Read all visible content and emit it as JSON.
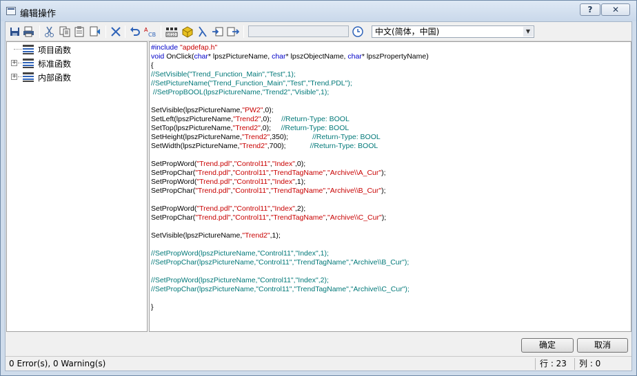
{
  "window": {
    "title": "编辑操作",
    "help_label": "?",
    "close_label": "✕"
  },
  "toolbar": {
    "language_value": "中文(简体，中国)",
    "icons": [
      "save-icon",
      "print-icon",
      "cut-icon",
      "copy-icon",
      "paste-icon",
      "format-icon",
      "delete-icon",
      "undo-icon",
      "abc-icon",
      "compile-icon",
      "cube-icon",
      "lambda-icon",
      "import-icon",
      "export-icon",
      "clock-icon"
    ]
  },
  "tree": {
    "items": [
      {
        "label": "项目函数",
        "expandable": false
      },
      {
        "label": "标准函数",
        "expandable": true
      },
      {
        "label": "内部函数",
        "expandable": true
      }
    ]
  },
  "editor": {
    "lines": [
      [
        [
          "kw",
          "#include "
        ],
        [
          "str",
          "\"apdefap.h\""
        ]
      ],
      [
        [
          "kw",
          "void "
        ],
        [
          "txt",
          "OnClick("
        ],
        [
          "kw",
          "char"
        ],
        [
          "txt",
          "* lpszPictureName, "
        ],
        [
          "kw",
          "char"
        ],
        [
          "txt",
          "* lpszObjectName, "
        ],
        [
          "kw",
          "char"
        ],
        [
          "txt",
          "* lpszPropertyName)"
        ]
      ],
      [
        [
          "txt",
          "{"
        ]
      ],
      [
        [
          "com",
          "//SetVisible(\"Trend_Function_Main\",\"Test\",1);"
        ]
      ],
      [
        [
          "com",
          "//SetPictureName(\"Trend_Function_Main\",\"Test\",\"Trend.PDL\");"
        ]
      ],
      [
        [
          "com",
          " //SetPropBOOL(lpszPictureName,\"Trend2\",\"Visible\",1);"
        ]
      ],
      [],
      [
        [
          "txt",
          "SetVisible(lpszPictureName,"
        ],
        [
          "str",
          "\"PW2\""
        ],
        [
          "txt",
          ",0);"
        ]
      ],
      [
        [
          "txt",
          "SetLeft(lpszPictureName,"
        ],
        [
          "str",
          "\"Trend2\""
        ],
        [
          "txt",
          ",0);     "
        ],
        [
          "com",
          "//Return-Type: BOOL"
        ]
      ],
      [
        [
          "txt",
          "SetTop(lpszPictureName,"
        ],
        [
          "str",
          "\"Trend2\""
        ],
        [
          "txt",
          ",0);     "
        ],
        [
          "com",
          "//Return-Type: BOOL"
        ]
      ],
      [
        [
          "txt",
          "SetHeight(lpszPictureName,"
        ],
        [
          "str",
          "\"Trend2\""
        ],
        [
          "txt",
          ",350);            "
        ],
        [
          "com",
          "//Return-Type: BOOL"
        ]
      ],
      [
        [
          "txt",
          "SetWidth(lpszPictureName,"
        ],
        [
          "str",
          "\"Trend2\""
        ],
        [
          "txt",
          ",700);            "
        ],
        [
          "com",
          "//Return-Type: BOOL"
        ]
      ],
      [],
      [
        [
          "txt",
          "SetPropWord("
        ],
        [
          "str",
          "\"Trend.pdl\""
        ],
        [
          "txt",
          ","
        ],
        [
          "str",
          "\"Control11\""
        ],
        [
          "txt",
          ","
        ],
        [
          "str",
          "\"Index\""
        ],
        [
          "txt",
          ",0);"
        ]
      ],
      [
        [
          "txt",
          "SetPropChar("
        ],
        [
          "str",
          "\"Trend.pdl\""
        ],
        [
          "txt",
          ","
        ],
        [
          "str",
          "\"Control11\""
        ],
        [
          "txt",
          ","
        ],
        [
          "str",
          "\"TrendTagName\""
        ],
        [
          "txt",
          ","
        ],
        [
          "str",
          "\"Archive\\\\A_Cur\""
        ],
        [
          "txt",
          ");"
        ]
      ],
      [
        [
          "txt",
          "SetPropWord("
        ],
        [
          "str",
          "\"Trend.pdl\""
        ],
        [
          "txt",
          ","
        ],
        [
          "str",
          "\"Control11\""
        ],
        [
          "txt",
          ","
        ],
        [
          "str",
          "\"Index\""
        ],
        [
          "txt",
          ",1);"
        ]
      ],
      [
        [
          "txt",
          "SetPropChar("
        ],
        [
          "str",
          "\"Trend.pdl\""
        ],
        [
          "txt",
          ","
        ],
        [
          "str",
          "\"Control11\""
        ],
        [
          "txt",
          ","
        ],
        [
          "str",
          "\"TrendTagName\""
        ],
        [
          "txt",
          ","
        ],
        [
          "str",
          "\"Archive\\\\B_Cur\""
        ],
        [
          "txt",
          ");"
        ]
      ],
      [],
      [
        [
          "txt",
          "SetPropWord("
        ],
        [
          "str",
          "\"Trend.pdl\""
        ],
        [
          "txt",
          ","
        ],
        [
          "str",
          "\"Control11\""
        ],
        [
          "txt",
          ","
        ],
        [
          "str",
          "\"Index\""
        ],
        [
          "txt",
          ",2);"
        ]
      ],
      [
        [
          "txt",
          "SetPropChar("
        ],
        [
          "str",
          "\"Trend.pdl\""
        ],
        [
          "txt",
          ","
        ],
        [
          "str",
          "\"Control11\""
        ],
        [
          "txt",
          ","
        ],
        [
          "str",
          "\"TrendTagName\""
        ],
        [
          "txt",
          ","
        ],
        [
          "str",
          "\"Archive\\\\C_Cur\""
        ],
        [
          "txt",
          ");"
        ]
      ],
      [],
      [
        [
          "txt",
          "SetVisible(lpszPictureName,"
        ],
        [
          "str",
          "\"Trend2\""
        ],
        [
          "txt",
          ",1);"
        ]
      ],
      [],
      [
        [
          "com",
          "//SetPropWord(lpszPictureName,\"Control11\",\"Index\",1);"
        ]
      ],
      [
        [
          "com",
          "//SetPropChar(lpszPictureName,\"Control11\",\"TrendTagName\",\"Archive\\\\B_Cur\");"
        ]
      ],
      [],
      [
        [
          "com",
          "//SetPropWord(lpszPictureName,\"Control11\",\"Index\",2);"
        ]
      ],
      [
        [
          "com",
          "//SetPropChar(lpszPictureName,\"Control11\",\"TrendTagName\",\"Archive\\\\C_Cur\");"
        ]
      ],
      [],
      [
        [
          "txt",
          "}"
        ]
      ]
    ]
  },
  "buttons": {
    "ok_label": "确定",
    "cancel_label": "取消"
  },
  "status": {
    "message": "0 Error(s), 0 Warning(s)",
    "row": "行 :  23",
    "col": "列 :  0"
  },
  "colors": {
    "keyword": "#0000c8",
    "string": "#c80000",
    "comment": "#007878",
    "title_bg": "#cfdceb"
  }
}
